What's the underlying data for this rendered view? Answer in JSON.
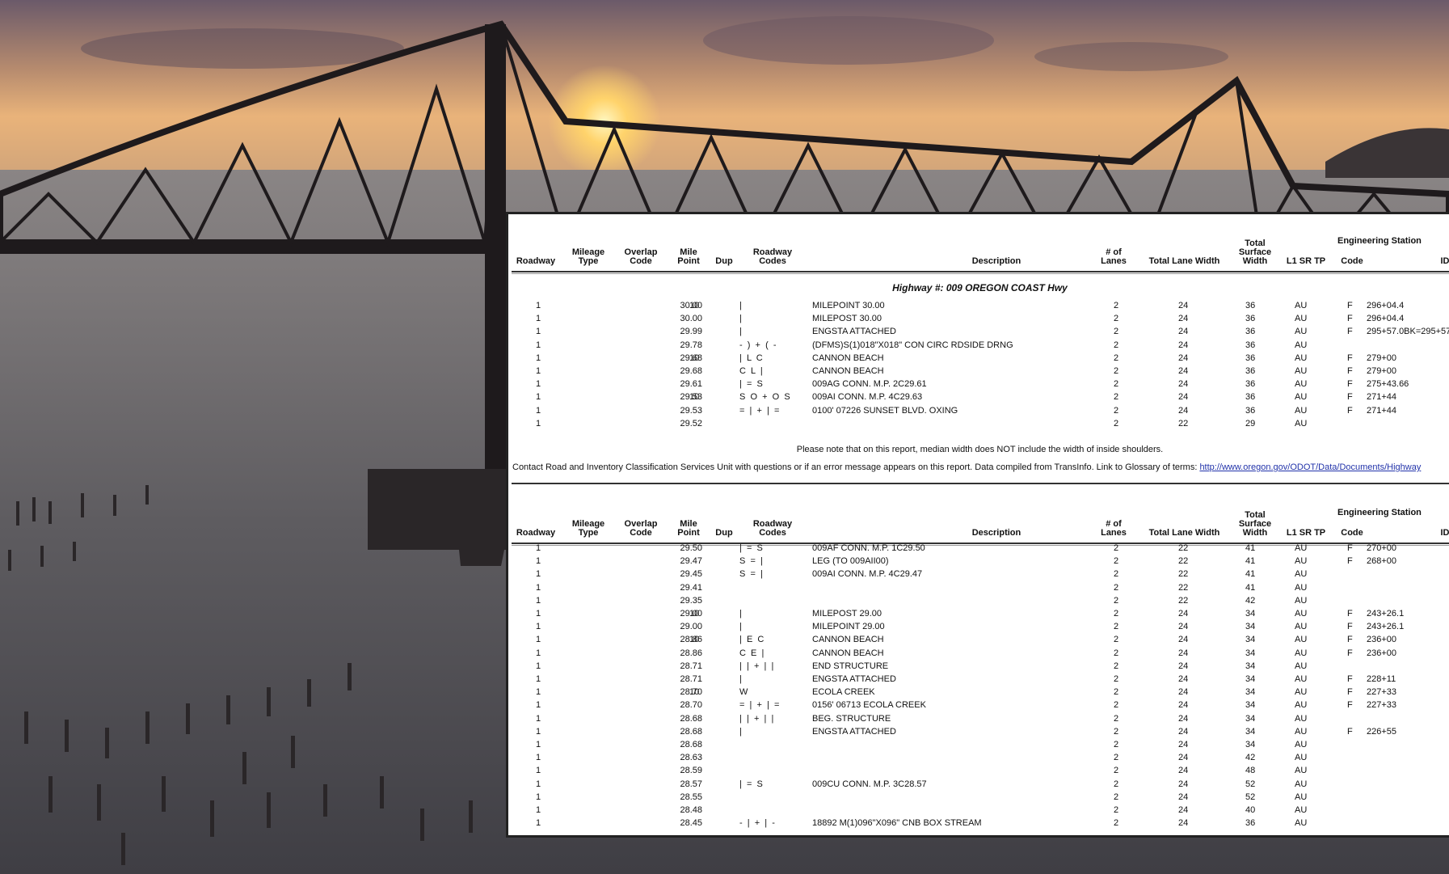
{
  "header": {
    "roadway": "Roadway",
    "mileage_type": [
      "Mileage",
      "Type"
    ],
    "overlap_code": [
      "Overlap",
      "Code"
    ],
    "mile_point": [
      "Mile",
      "Point"
    ],
    "dup": "Dup",
    "roadway_codes": [
      "Roadway",
      "Codes"
    ],
    "description": "Description",
    "lanes": [
      "# of",
      "Lanes"
    ],
    "total_lane_width": "Total Lane Width",
    "total_surface_width": [
      "Total",
      "Surface",
      "Width"
    ],
    "l1_sr_tp": "L1 SR TP",
    "engineering_station": "Engineering Station",
    "code": "Code",
    "id": "ID"
  },
  "highway_title": "Highway #: 009 OREGON COAST Hwy",
  "note": "Please note that on this report, median width does NOT include the width of inside shoulders.",
  "contact_text": "Contact Road and Inventory Classification Services Unit with questions or if an error message appears on this report. Data compiled from TransInfo. Link to Glossary of terms: ",
  "contact_link": "http://www.oregon.gov/ODOT/Data/Documents/Highway",
  "table1": [
    {
      "rw": "1",
      "mp": "30.00",
      "dup": "10",
      "codes": "|",
      "desc": "MILEPOINT 30.00",
      "lanes": "2",
      "tlw": "24",
      "tsw": "36",
      "l1": "AU",
      "ec": "F",
      "sta": "296+04.4"
    },
    {
      "rw": "1",
      "mp": "30.00",
      "dup": "",
      "codes": "|",
      "desc": "MILEPOST 30.00",
      "lanes": "2",
      "tlw": "24",
      "tsw": "36",
      "l1": "AU",
      "ec": "F",
      "sta": "296+04.4"
    },
    {
      "rw": "1",
      "mp": "29.99",
      "dup": "",
      "codes": "|",
      "desc": "ENGSTA ATTACHED",
      "lanes": "2",
      "tlw": "24",
      "tsw": "36",
      "l1": "AU",
      "ec": "F",
      "sta": "295+57.0BK=295+57"
    },
    {
      "rw": "1",
      "mp": "29.78",
      "dup": "",
      "codes": "-  )  +  (  -",
      "desc": "(DFMS)S(1)018\"X018\" CON CIRC RDSIDE DRNG",
      "lanes": "2",
      "tlw": "24",
      "tsw": "36",
      "l1": "AU",
      "ec": "",
      "sta": ""
    },
    {
      "rw": "1",
      "mp": "29.68",
      "dup": "10",
      "codes": "|  L  C",
      "desc": "CANNON BEACH",
      "lanes": "2",
      "tlw": "24",
      "tsw": "36",
      "l1": "AU",
      "ec": "F",
      "sta": "279+00"
    },
    {
      "rw": "1",
      "mp": "29.68",
      "dup": "",
      "codes": "C  L  |",
      "desc": "CANNON BEACH",
      "lanes": "2",
      "tlw": "24",
      "tsw": "36",
      "l1": "AU",
      "ec": "F",
      "sta": "279+00"
    },
    {
      "rw": "1",
      "mp": "29.61",
      "dup": "",
      "codes": "|  =  S",
      "desc": "009AG CONN. M.P. 2C29.61",
      "lanes": "2",
      "tlw": "24",
      "tsw": "36",
      "l1": "AU",
      "ec": "F",
      "sta": "275+43.66"
    },
    {
      "rw": "1",
      "mp": "29.53",
      "dup": "10",
      "codes": "S  O  +  O  S",
      "desc": "009AI CONN. M.P. 4C29.63",
      "lanes": "2",
      "tlw": "24",
      "tsw": "36",
      "l1": "AU",
      "ec": "F",
      "sta": "271+44"
    },
    {
      "rw": "1",
      "mp": "29.53",
      "dup": "",
      "codes": "=  |  +  |  =",
      "desc": "0100' 07226 SUNSET BLVD. OXING",
      "lanes": "2",
      "tlw": "24",
      "tsw": "36",
      "l1": "AU",
      "ec": "F",
      "sta": "271+44"
    },
    {
      "rw": "1",
      "mp": "29.52",
      "dup": "",
      "codes": "",
      "desc": "",
      "lanes": "2",
      "tlw": "22",
      "tsw": "29",
      "l1": "AU",
      "ec": "",
      "sta": ""
    }
  ],
  "table2": [
    {
      "rw": "1",
      "mp": "29.50",
      "dup": "",
      "codes": "|  =  S",
      "desc": "009AF CONN. M.P. 1C29.50",
      "lanes": "2",
      "tlw": "22",
      "tsw": "41",
      "l1": "AU",
      "ec": "F",
      "sta": "270+00"
    },
    {
      "rw": "1",
      "mp": "29.47",
      "dup": "",
      "codes": "S  =  |",
      "desc": "LEG (TO 009AII00)",
      "lanes": "2",
      "tlw": "22",
      "tsw": "41",
      "l1": "AU",
      "ec": "F",
      "sta": "268+00"
    },
    {
      "rw": "1",
      "mp": "29.45",
      "dup": "",
      "codes": "S  =  |",
      "desc": "009AI CONN. M.P. 4C29.47",
      "lanes": "2",
      "tlw": "22",
      "tsw": "41",
      "l1": "AU",
      "ec": "",
      "sta": ""
    },
    {
      "rw": "1",
      "mp": "29.41",
      "dup": "",
      "codes": "",
      "desc": "",
      "lanes": "2",
      "tlw": "22",
      "tsw": "41",
      "l1": "AU",
      "ec": "",
      "sta": ""
    },
    {
      "rw": "1",
      "mp": "29.35",
      "dup": "",
      "codes": "",
      "desc": "",
      "lanes": "2",
      "tlw": "22",
      "tsw": "42",
      "l1": "AU",
      "ec": "",
      "sta": ""
    },
    {
      "rw": "1",
      "mp": "29.00",
      "dup": "10",
      "codes": "|",
      "desc": "MILEPOST 29.00",
      "lanes": "2",
      "tlw": "24",
      "tsw": "34",
      "l1": "AU",
      "ec": "F",
      "sta": "243+26.1"
    },
    {
      "rw": "1",
      "mp": "29.00",
      "dup": "",
      "codes": "|",
      "desc": "MILEPOINT 29.00",
      "lanes": "2",
      "tlw": "24",
      "tsw": "34",
      "l1": "AU",
      "ec": "F",
      "sta": "243+26.1"
    },
    {
      "rw": "1",
      "mp": "28.86",
      "dup": "10",
      "codes": "|  E  C",
      "desc": "CANNON BEACH",
      "lanes": "2",
      "tlw": "24",
      "tsw": "34",
      "l1": "AU",
      "ec": "F",
      "sta": "236+00"
    },
    {
      "rw": "1",
      "mp": "28.86",
      "dup": "",
      "codes": "C  E  |",
      "desc": "CANNON BEACH",
      "lanes": "2",
      "tlw": "24",
      "tsw": "34",
      "l1": "AU",
      "ec": "F",
      "sta": "236+00"
    },
    {
      "rw": "1",
      "mp": "28.71",
      "dup": "",
      "codes": "|  |  +  |  |",
      "desc": "END STRUCTURE",
      "lanes": "2",
      "tlw": "24",
      "tsw": "34",
      "l1": "AU",
      "ec": "",
      "sta": ""
    },
    {
      "rw": "1",
      "mp": "28.71",
      "dup": "",
      "codes": "|",
      "desc": "ENGSTA ATTACHED",
      "lanes": "2",
      "tlw": "24",
      "tsw": "34",
      "l1": "AU",
      "ec": "F",
      "sta": "228+11"
    },
    {
      "rw": "1",
      "mp": "28.70",
      "dup": "10",
      "codes": "W",
      "desc": "ECOLA CREEK",
      "lanes": "2",
      "tlw": "24",
      "tsw": "34",
      "l1": "AU",
      "ec": "F",
      "sta": "227+33"
    },
    {
      "rw": "1",
      "mp": "28.70",
      "dup": "",
      "codes": "=  |  +  |  =",
      "desc": "0156' 06713 ECOLA CREEK",
      "lanes": "2",
      "tlw": "24",
      "tsw": "34",
      "l1": "AU",
      "ec": "F",
      "sta": "227+33"
    },
    {
      "rw": "1",
      "mp": "28.68",
      "dup": "",
      "codes": "|  |  +  |  |",
      "desc": "BEG. STRUCTURE",
      "lanes": "2",
      "tlw": "24",
      "tsw": "34",
      "l1": "AU",
      "ec": "",
      "sta": ""
    },
    {
      "rw": "1",
      "mp": "28.68",
      "dup": "",
      "codes": "|",
      "desc": "ENGSTA ATTACHED",
      "lanes": "2",
      "tlw": "24",
      "tsw": "34",
      "l1": "AU",
      "ec": "F",
      "sta": "226+55"
    },
    {
      "rw": "1",
      "mp": "28.68",
      "dup": "",
      "codes": "",
      "desc": "",
      "lanes": "2",
      "tlw": "24",
      "tsw": "34",
      "l1": "AU",
      "ec": "",
      "sta": ""
    },
    {
      "rw": "1",
      "mp": "28.63",
      "dup": "",
      "codes": "",
      "desc": "",
      "lanes": "2",
      "tlw": "24",
      "tsw": "42",
      "l1": "AU",
      "ec": "",
      "sta": ""
    },
    {
      "rw": "1",
      "mp": "28.59",
      "dup": "",
      "codes": "",
      "desc": "",
      "lanes": "2",
      "tlw": "24",
      "tsw": "48",
      "l1": "AU",
      "ec": "",
      "sta": ""
    },
    {
      "rw": "1",
      "mp": "28.57",
      "dup": "",
      "codes": "|  =  S",
      "desc": "009CU CONN. M.P. 3C28.57",
      "lanes": "2",
      "tlw": "24",
      "tsw": "52",
      "l1": "AU",
      "ec": "",
      "sta": ""
    },
    {
      "rw": "1",
      "mp": "28.55",
      "dup": "",
      "codes": "",
      "desc": "",
      "lanes": "2",
      "tlw": "24",
      "tsw": "52",
      "l1": "AU",
      "ec": "",
      "sta": ""
    },
    {
      "rw": "1",
      "mp": "28.48",
      "dup": "",
      "codes": "",
      "desc": "",
      "lanes": "2",
      "tlw": "24",
      "tsw": "40",
      "l1": "AU",
      "ec": "",
      "sta": ""
    },
    {
      "rw": "1",
      "mp": "28.45",
      "dup": "",
      "codes": "-  |  +  |  -",
      "desc": "18892 M(1)096\"X096\" CNB BOX STREAM",
      "lanes": "2",
      "tlw": "24",
      "tsw": "36",
      "l1": "AU",
      "ec": "",
      "sta": ""
    }
  ]
}
